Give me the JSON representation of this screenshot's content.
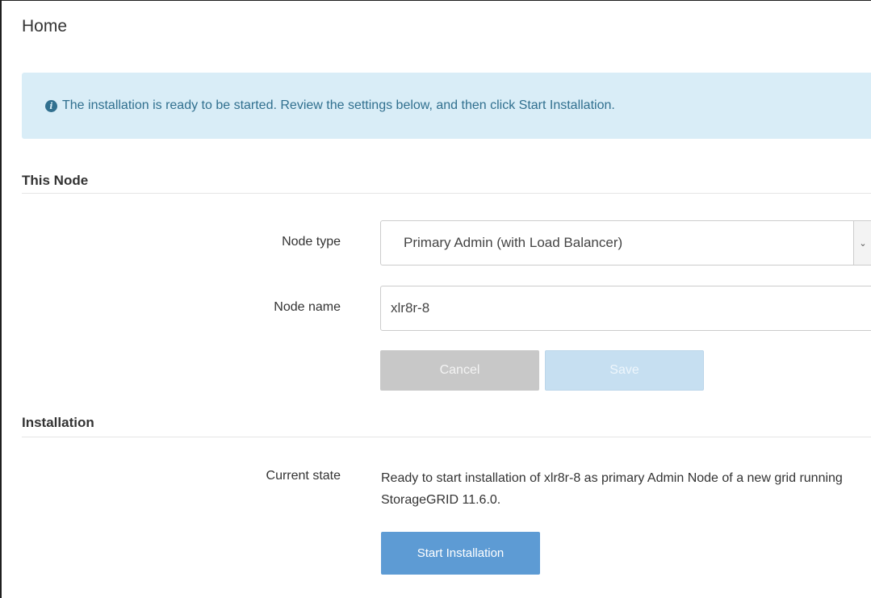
{
  "page": {
    "title": "Home"
  },
  "alert": {
    "icon": "info-icon",
    "icon_glyph": "i",
    "message": "The installation is ready to be started. Review the settings below, and then click Start Installation.",
    "color": "#31708f",
    "background": "#d9edf7"
  },
  "this_node": {
    "heading": "This Node",
    "node_type_label": "Node type",
    "node_type_value": "Primary Admin (with Load Balancer)",
    "node_name_label": "Node name",
    "node_name_value": "xlr8r-8",
    "cancel_label": "Cancel",
    "save_label": "Save"
  },
  "installation": {
    "heading": "Installation",
    "current_state_label": "Current state",
    "current_state_text": "Ready to start installation of xlr8r-8 as primary Admin Node of a new grid running StorageGRID 11.6.0.",
    "start_label": "Start Installation",
    "start_color": "#5d9bd4"
  }
}
